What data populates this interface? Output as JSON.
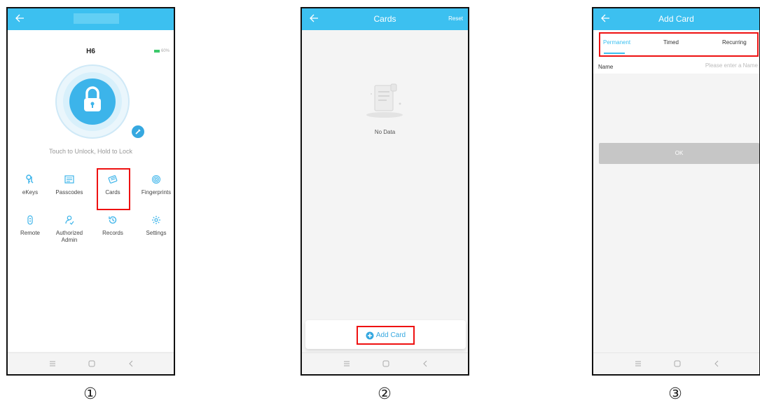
{
  "screen1": {
    "device_name": "H6",
    "battery": "60%",
    "helper_text": "Touch to Unlock, Hold to Lock",
    "menu": [
      {
        "label": "eKeys",
        "icon": "ekeys-icon"
      },
      {
        "label": "Passcodes",
        "icon": "passcodes-icon"
      },
      {
        "label": "Cards",
        "icon": "cards-icon"
      },
      {
        "label": "Fingerprints",
        "icon": "fingerprints-icon"
      },
      {
        "label": "Remote",
        "icon": "remote-icon"
      },
      {
        "label": "Authorized Admin",
        "icon": "authorized-admin-icon"
      },
      {
        "label": "Records",
        "icon": "records-icon"
      },
      {
        "label": "Settings",
        "icon": "settings-icon"
      }
    ],
    "marker": "①"
  },
  "screen2": {
    "title": "Cards",
    "reset": "Reset",
    "empty_text": "No Data",
    "add_button": "Add Card",
    "marker": "②"
  },
  "screen3": {
    "title": "Add Card",
    "tabs": [
      "Permanent",
      "Timed",
      "Recurring"
    ],
    "name_label": "Name",
    "name_placeholder": "Please enter a Name",
    "ok": "OK",
    "marker": "③"
  },
  "colors": {
    "header": "#3cc0f0",
    "accent": "#36a8e0",
    "highlight": "#e11111",
    "battery": "#3cc96b"
  }
}
